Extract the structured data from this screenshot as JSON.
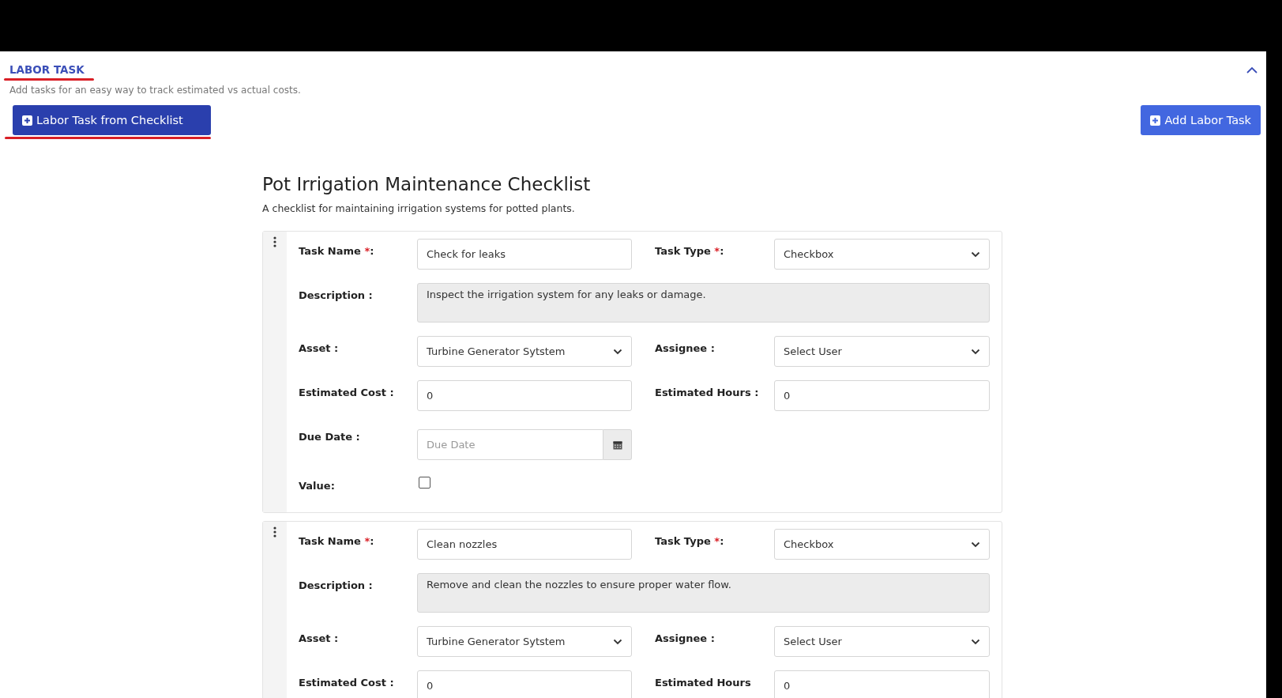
{
  "section": {
    "title": "LABOR TASK",
    "subtitle": "Add tasks for an easy way to track estimated vs actual costs.",
    "expanded": true
  },
  "buttons": [
    {
      "label": "Labor Task from Checklist",
      "kind": "checklist"
    },
    {
      "label": "Add Labor Task",
      "kind": "add"
    }
  ],
  "checklist": {
    "title": "Pot Irrigation Maintenance Checklist",
    "description": "A checklist for maintaining irrigation systems for potted plants.",
    "tasks": [
      {
        "rows": [
          [
            {
              "kind": "text",
              "label": "Task Name",
              "required_mark": "*",
              "colon": ":",
              "value": "Check for leaks"
            },
            {
              "kind": "select",
              "label": "Task Type",
              "required_mark": "*",
              "colon": ":",
              "value": "Checkbox"
            }
          ],
          [
            {
              "kind": "textarea",
              "label": "Description :",
              "value": "Inspect the irrigation system for any leaks or damage."
            }
          ],
          [
            {
              "kind": "select",
              "label": "Asset :",
              "value": "Turbine Generator Sytstem"
            },
            {
              "kind": "select",
              "label": "Assignee :",
              "value": "Select User"
            }
          ],
          [
            {
              "kind": "text",
              "label": "Estimated Cost :",
              "value": "0"
            },
            {
              "kind": "text",
              "label": "Estimated Hours :",
              "value": "0"
            }
          ],
          [
            {
              "kind": "date",
              "label": "Due Date :",
              "placeholder": "Due Date"
            }
          ],
          [
            {
              "kind": "checkbox",
              "label": "Value:",
              "checked": false
            }
          ]
        ]
      },
      {
        "rows": [
          [
            {
              "kind": "text",
              "label": "Task Name",
              "required_mark": "*",
              "colon": ":",
              "value": "Clean nozzles"
            },
            {
              "kind": "select",
              "label": "Task Type",
              "required_mark": "*",
              "colon": ":",
              "value": "Checkbox"
            }
          ],
          [
            {
              "kind": "textarea",
              "label": "Description :",
              "value": "Remove and clean the nozzles to ensure proper water flow."
            }
          ],
          [
            {
              "kind": "select",
              "label": "Asset :",
              "value": "Turbine Generator Sytstem"
            },
            {
              "kind": "select",
              "label": "Assignee :",
              "value": "Select User"
            }
          ],
          [
            {
              "kind": "text",
              "label": "Estimated Cost :",
              "value": "0"
            },
            {
              "kind": "text",
              "label": "Estimated Hours",
              "value": "0"
            }
          ]
        ]
      }
    ]
  }
}
